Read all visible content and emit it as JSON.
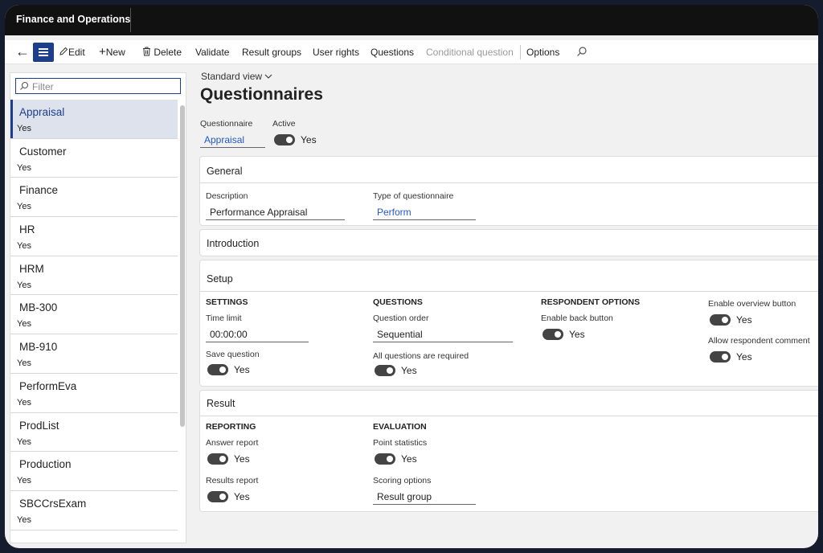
{
  "app": {
    "title": "Finance and Operations"
  },
  "actions": {
    "edit": "Edit",
    "new": "New",
    "delete": "Delete",
    "validate": "Validate",
    "result_groups": "Result groups",
    "user_rights": "User rights",
    "questions": "Questions",
    "conditional_question": "Conditional question",
    "options": "Options"
  },
  "filter": {
    "placeholder": "Filter"
  },
  "list": [
    {
      "name": "Appraisal",
      "status": "Yes",
      "selected": true
    },
    {
      "name": "Customer",
      "status": "Yes"
    },
    {
      "name": "Finance",
      "status": "Yes"
    },
    {
      "name": "HR",
      "status": "Yes"
    },
    {
      "name": "HRM",
      "status": "Yes"
    },
    {
      "name": "MB-300",
      "status": "Yes"
    },
    {
      "name": "MB-910",
      "status": "Yes"
    },
    {
      "name": "PerformEva",
      "status": "Yes"
    },
    {
      "name": "ProdList",
      "status": "Yes"
    },
    {
      "name": "Production",
      "status": "Yes"
    },
    {
      "name": "SBCCrsExam",
      "status": "Yes"
    }
  ],
  "view": {
    "label": "Standard view"
  },
  "page": {
    "title": "Questionnaires"
  },
  "header": {
    "questionnaire_label": "Questionnaire",
    "questionnaire_value": "Appraisal",
    "active_label": "Active",
    "active_value": "Yes"
  },
  "general": {
    "title": "General",
    "description_label": "Description",
    "description_value": "Performance Appraisal",
    "type_label": "Type of questionnaire",
    "type_value": "Perform"
  },
  "introduction": {
    "title": "Introduction"
  },
  "setup": {
    "title": "Setup",
    "settings_title": "SETTINGS",
    "time_limit_label": "Time limit",
    "time_limit_value": "00:00:00",
    "save_question_label": "Save question",
    "save_question_value": "Yes",
    "questions_title": "QUESTIONS",
    "question_order_label": "Question order",
    "question_order_value": "Sequential",
    "all_required_label": "All questions are required",
    "all_required_value": "Yes",
    "respondent_title": "RESPONDENT OPTIONS",
    "back_button_label": "Enable back button",
    "back_button_value": "Yes",
    "overview_label": "Enable overview button",
    "overview_value": "Yes",
    "comment_label": "Allow respondent comment",
    "comment_value": "Yes"
  },
  "result": {
    "title": "Result",
    "reporting_title": "REPORTING",
    "answer_report_label": "Answer report",
    "answer_report_value": "Yes",
    "results_report_label": "Results report",
    "results_report_value": "Yes",
    "evaluation_title": "EVALUATION",
    "point_stats_label": "Point statistics",
    "point_stats_value": "Yes",
    "scoring_label": "Scoring options",
    "scoring_value": "Result group"
  },
  "colors": {
    "accent": "#1d3e8a",
    "link": "#2459c6",
    "topbar": "#111111"
  }
}
